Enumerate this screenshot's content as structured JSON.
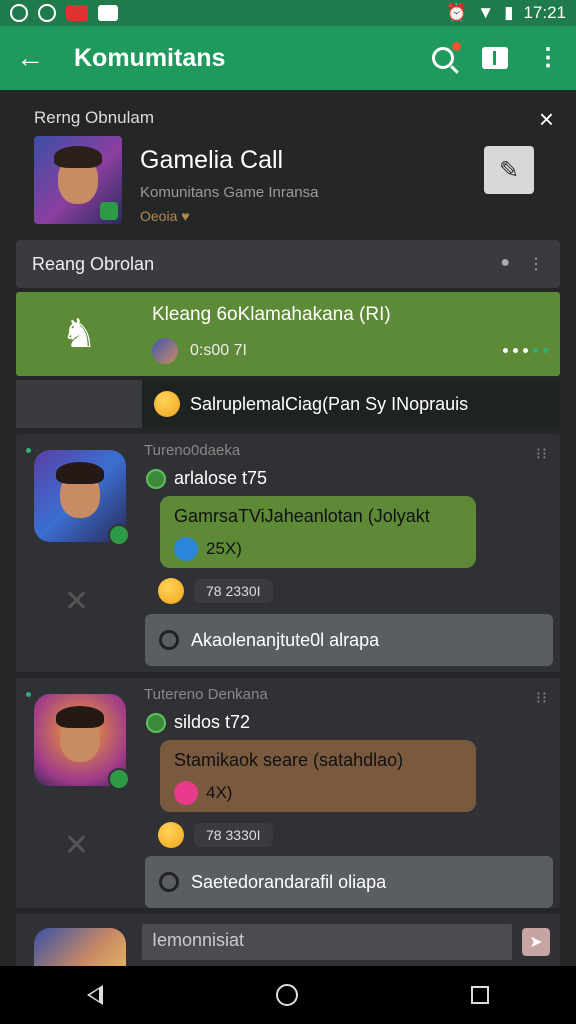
{
  "statusbar": {
    "time": "17:21"
  },
  "appbar": {
    "title": "Komumitans",
    "back_glyph": "←",
    "kebab_glyph": "⋮"
  },
  "header": {
    "label": "Rerng Obnulam",
    "title": "Gamelia Call",
    "subtitle": "Komunitans Game Inransa",
    "subtitle2": "Oeoia ♥",
    "close_glyph": "×",
    "pin_glyph": "✎"
  },
  "room_bar": {
    "label": "Reang Obrolan"
  },
  "call": {
    "title": "Kleang 6oKlamahakana (RI)",
    "time": "0:s00 7I"
  },
  "topic": {
    "text": "SalruplemalCiag(Pan Sy INoprauis"
  },
  "messages": [
    {
      "name": "Tureno0daeka",
      "user": "arlalose t75",
      "bubble_text": "GamrsaTViJaheanlotan (Jolyakt",
      "bubble_sub": "25X)",
      "bubble_color": "#5e8a38",
      "bubble_icon_color": "#2a86d8",
      "reaction_count": "78 2330I",
      "reply_text": "Akaolenanjtute0l alrapa"
    },
    {
      "name": "Tutereno Denkana",
      "user": "sildos t72",
      "bubble_text": "Stamikaok seare (satahdlao)",
      "bubble_sub": "4X)",
      "bubble_color": "#7a5a3e",
      "bubble_icon_color": "#e83a8a",
      "reaction_count": "78 3330I",
      "reply_text": "Saetedorandarafil oliapa"
    }
  ],
  "composer": {
    "placeholder": "Iemonnisiat"
  },
  "colors": {
    "appbar": "#1f9a5c",
    "statusbar": "#1f7a4c",
    "call_card": "#5c8a36",
    "reply": "#5a5d62"
  }
}
